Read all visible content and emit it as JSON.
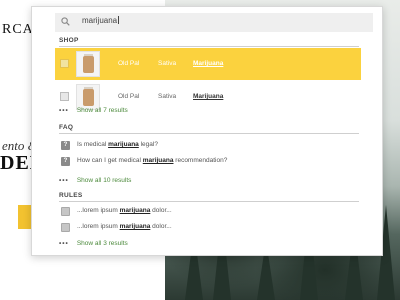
{
  "background": {
    "brand_partial": "RCAN",
    "hero_italic_partial": "ento &",
    "hero_bold_partial": "DELI"
  },
  "search": {
    "value": "marijuana"
  },
  "shop": {
    "title": "SHOP",
    "rows": [
      {
        "name": "Old Pal",
        "type": "Sativa",
        "category": "Marijuana",
        "highlighted": true
      },
      {
        "name": "Old Pal",
        "type": "Sativa",
        "category": "Marijuana",
        "highlighted": false
      }
    ],
    "show_all": "Show all 7 results"
  },
  "faq": {
    "title": "FAQ",
    "items": [
      {
        "icon": "?",
        "before": "Is medical ",
        "keyword": "marijuana",
        "after": " legal?"
      },
      {
        "icon": "?",
        "before": "How can I get medical ",
        "keyword": "marijuana",
        "after": " recommendation?"
      }
    ],
    "show_all": "Show all 10 results"
  },
  "rules": {
    "title": "RULES",
    "items": [
      {
        "before": "...lorem ipsum ",
        "keyword": "marijuana",
        "after": " dolor..."
      },
      {
        "before": "...lorem ipsum ",
        "keyword": "marijuana",
        "after": " dolor..."
      }
    ],
    "show_all": "Show all 3 results"
  },
  "more_dots": "•••",
  "colors": {
    "highlight": "#fbd23e",
    "link_green": "#4c8a3c",
    "cta_yellow": "#f2c230"
  }
}
